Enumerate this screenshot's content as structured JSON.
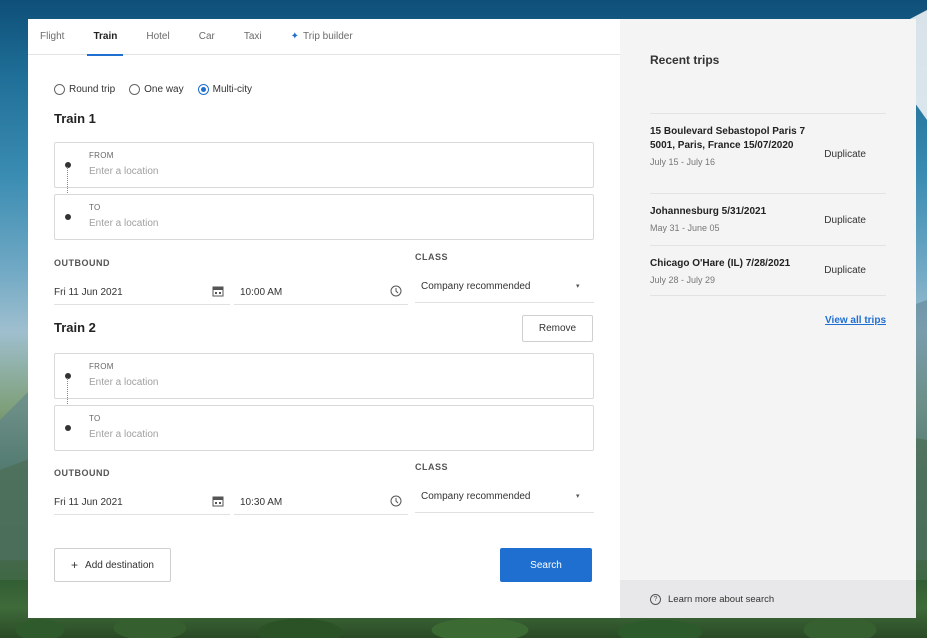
{
  "tabs": [
    {
      "label": "Flight"
    },
    {
      "label": "Train"
    },
    {
      "label": "Hotel"
    },
    {
      "label": "Car"
    },
    {
      "label": "Taxi"
    },
    {
      "label": "Trip builder",
      "icon": "sparkle-icon"
    }
  ],
  "active_tab": "Train",
  "trip_type": {
    "options": [
      "Round trip",
      "One way",
      "Multi-city"
    ],
    "selected": "Multi-city"
  },
  "legs": [
    {
      "title": "Train 1",
      "from_label": "FROM",
      "from_placeholder": "Enter a location",
      "to_label": "TO",
      "to_placeholder": "Enter a location",
      "outbound_label": "OUTBOUND",
      "date": "Fri 11 Jun 2021",
      "time": "10:00 AM",
      "class_label": "CLASS",
      "class_value": "Company recommended"
    },
    {
      "title": "Train 2",
      "remove_label": "Remove",
      "from_label": "FROM",
      "from_placeholder": "Enter a location",
      "to_label": "TO",
      "to_placeholder": "Enter a location",
      "outbound_label": "OUTBOUND",
      "date": "Fri 11 Jun 2021",
      "time": "10:30 AM",
      "class_label": "CLASS",
      "class_value": "Company recommended"
    }
  ],
  "add_destination_label": "Add destination",
  "search_label": "Search",
  "recent": {
    "title": "Recent trips",
    "trips": [
      {
        "name": "15 Boulevard Sebastopol Paris 75001, Paris, France 15/07/2020",
        "dates": "July 15 - July 16",
        "action": "Duplicate"
      },
      {
        "name": "Johannesburg 5/31/2021",
        "dates": "May 31 - June 05",
        "action": "Duplicate"
      },
      {
        "name": "Chicago O'Hare (IL) 7/28/2021",
        "dates": "July 28 - July 29",
        "action": "Duplicate"
      }
    ],
    "view_all": "View all trips",
    "learn_more": "Learn more about search"
  },
  "colors": {
    "accent": "#1f6fd1",
    "panel": "#f4f4f5"
  }
}
